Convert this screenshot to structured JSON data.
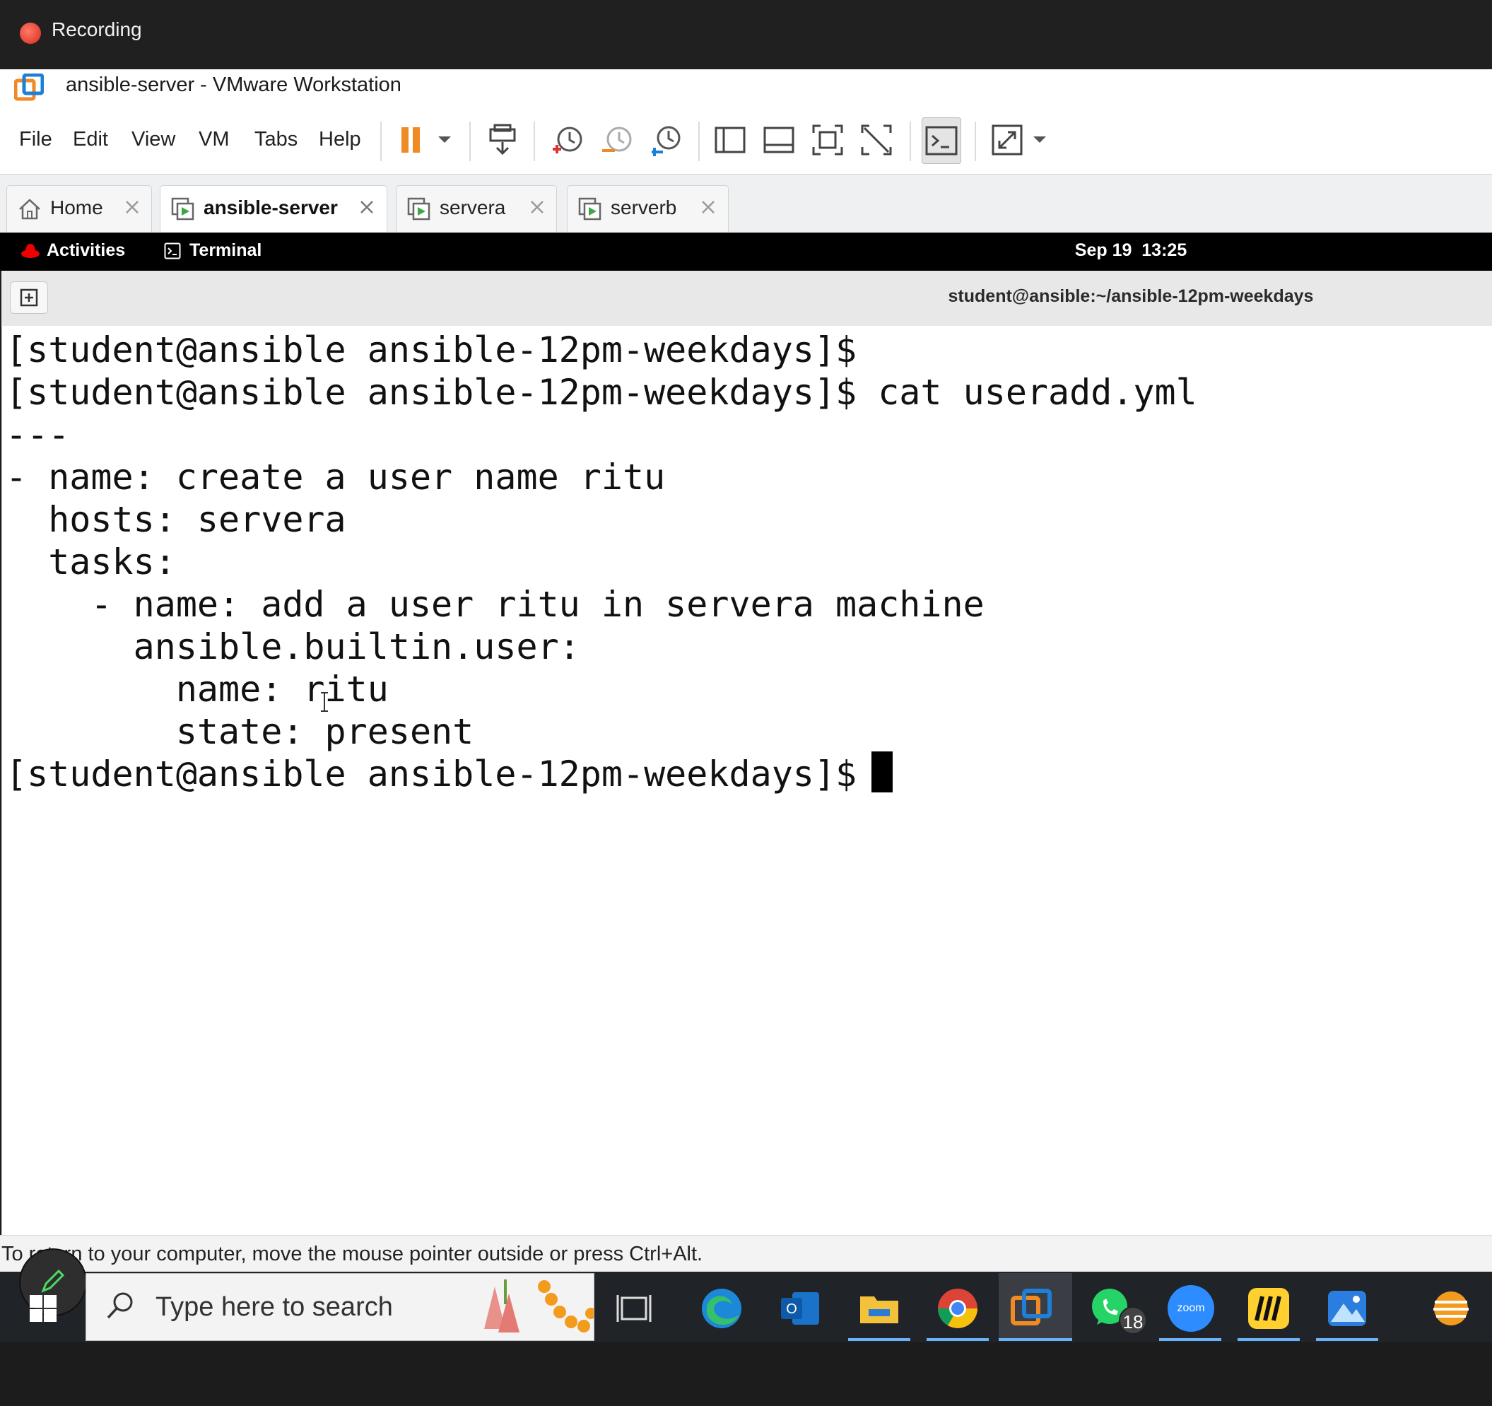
{
  "recording": {
    "label": "Recording"
  },
  "window": {
    "title": "ansible-server - VMware Workstation"
  },
  "menu": {
    "file": "File",
    "edit": "Edit",
    "view": "View",
    "vm": "VM",
    "tabs": "Tabs",
    "help": "Help"
  },
  "tabs": [
    {
      "label": "Home"
    },
    {
      "label": "ansible-server"
    },
    {
      "label": "servera"
    },
    {
      "label": "serverb"
    }
  ],
  "gnome": {
    "activities": "Activities",
    "app": "Terminal",
    "clock": "Sep 19  13:25"
  },
  "terminal": {
    "title": "student@ansible:~/ansible-12pm-weekdays",
    "content": "[student@ansible ansible-12pm-weekdays]$\n[student@ansible ansible-12pm-weekdays]$ cat useradd.yml\n---\n- name: create a user name ritu\n  hosts: servera\n  tasks:\n    - name: add a user ritu in servera machine\n      ansible.builtin.user:\n        name: ritu\n        state: present\n[student@ansible ansible-12pm-weekdays]$ "
  },
  "status": {
    "hint": "To return to your computer, move the mouse pointer outside or press Ctrl+Alt."
  },
  "taskbar": {
    "search_placeholder": "Type here to search",
    "whatsapp_badge": "18",
    "zoom_label": "zoom"
  },
  "colors": {
    "accent": "#0078d4",
    "pause": "#f08a24",
    "recording": "#d8281b"
  }
}
